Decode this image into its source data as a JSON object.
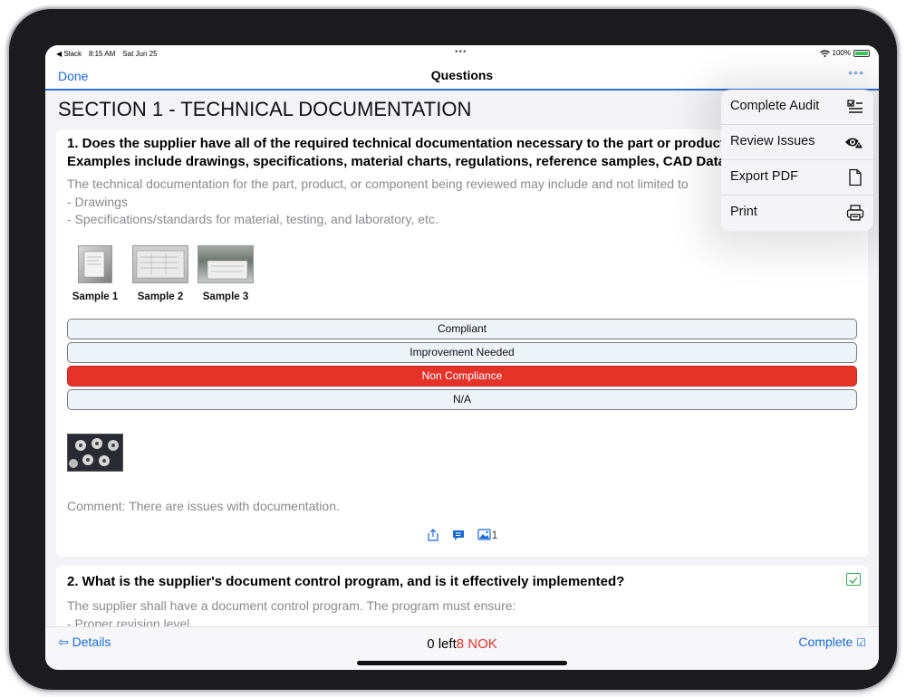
{
  "status_bar": {
    "back_app": "◀ Slack",
    "time": "8:15 AM",
    "date": "Sat Jun 25",
    "battery": "100%"
  },
  "nav": {
    "done_label": "Done",
    "title": "Questions"
  },
  "section_title": "SECTION 1 - TECHNICAL DOCUMENTATION",
  "question1": {
    "title_line1": "1. Does the supplier have all of the required technical documentation necessary to the part or product being",
    "title_line2": "Examples include drawings, specifications, material charts, regulations, reference samples, CAD Data, etc.",
    "desc_line1": "The technical documentation for the part, product, or component being reviewed may include and not limited to",
    "desc_line2": "- Drawings",
    "desc_line3": "- Specifications/standards for material, testing, and laboratory, etc.",
    "samples": [
      "Sample 1",
      "Sample 2",
      "Sample 3"
    ],
    "options": [
      "Compliant",
      "Improvement Needed",
      "Non Compliance",
      "N/A"
    ],
    "selected_option": "Non Compliance",
    "comment": "Comment: There are issues with documentation.",
    "photo_count": "1"
  },
  "question2": {
    "title": "2. What is the supplier's document control program, and is it effectively implemented?",
    "desc_line1": "The supplier shall have a document control program. The program must ensure:",
    "desc_line2": "- Proper revision level"
  },
  "bottom_bar": {
    "details_label": "Details",
    "left_count": "0 left",
    "nok_count": "8 NOK",
    "complete_label": "Complete"
  },
  "menu": {
    "items": [
      {
        "label": "Complete Audit",
        "icon": "checklist-icon"
      },
      {
        "label": "Review Issues",
        "icon": "eye-warning-icon"
      },
      {
        "label": "Export PDF",
        "icon": "document-icon"
      },
      {
        "label": "Print",
        "icon": "printer-icon"
      }
    ]
  },
  "colors": {
    "accent": "#1a6bd6",
    "non_compliance": "#e5332a",
    "nok_text": "#e5332a"
  }
}
